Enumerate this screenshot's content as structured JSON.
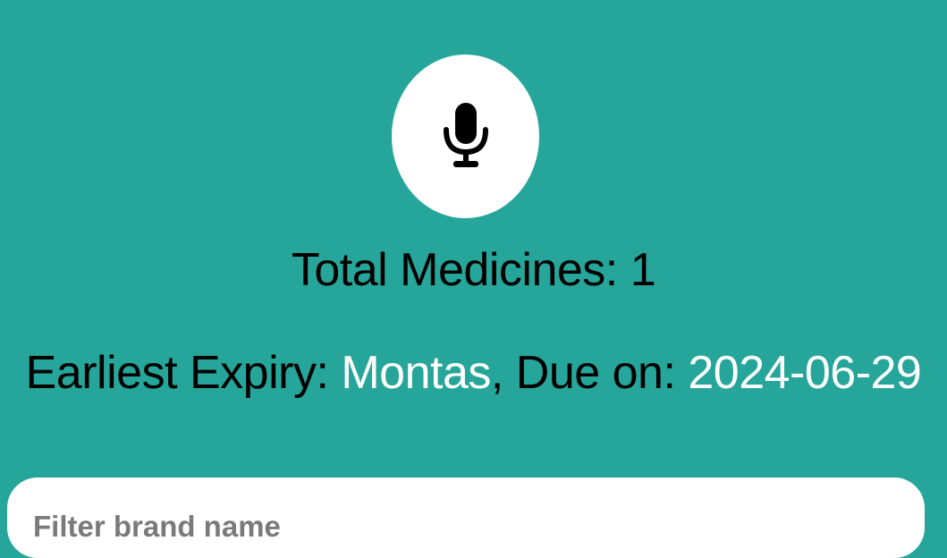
{
  "mic": {
    "icon": "microphone-icon"
  },
  "summary": {
    "total_label": "Total Medicines:",
    "total_value": "1",
    "earliest_label": "Earliest Expiry:",
    "earliest_name": "Montas",
    "due_label": ", Due on:",
    "due_date": "2024-06-29"
  },
  "filter": {
    "placeholder": "Filter brand name",
    "value": ""
  },
  "colors": {
    "background": "#26a69a",
    "highlight": "#ffffff",
    "text": "#000000"
  }
}
